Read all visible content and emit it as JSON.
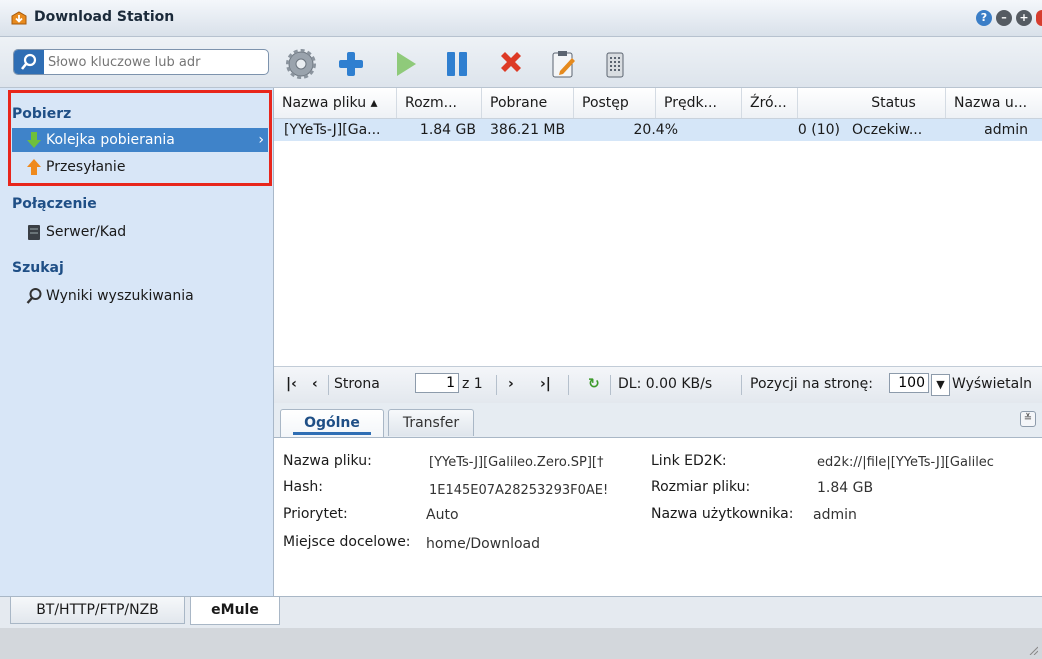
{
  "window": {
    "title": "Download Station"
  },
  "search": {
    "placeholder": "Słowo kluczowe lub adr"
  },
  "sidebar": {
    "group1": "Pobierz",
    "queue": "Kolejka pobierania",
    "upload": "Przesyłanie",
    "group2": "Połączenie",
    "server": "Serwer/Kad",
    "group3": "Szukaj",
    "results": "Wyniki wyszukiwania"
  },
  "grid": {
    "columns": [
      "Nazwa pliku ▴",
      "Rozm...",
      "Pobrane",
      "Postęp",
      "Prędk...",
      "Źró...",
      "Status",
      "Nazwa u..."
    ],
    "rows": [
      [
        "[YYeTs-J][Ga...",
        "1.84 GB",
        "386.21 MB",
        "20.4%",
        "",
        "0 (10)",
        "Oczekiw...",
        "admin"
      ]
    ]
  },
  "pager": {
    "page_label": "Strona",
    "page_value": "1",
    "of_label": "z 1",
    "dl_speed": "DL: 0.00 KB/s",
    "per_page_label": "Pozycji na stronę:",
    "per_page_value": "100",
    "display_label": "Wyświetaln"
  },
  "details": {
    "tabs": [
      "Ogólne",
      "Transfer"
    ],
    "filename_label": "Nazwa pliku:",
    "filename_value": "[YYeTs-J][Galileo.Zero.SP][†",
    "hash_label": "Hash:",
    "hash_value": "1E145E07A28253293F0AE!",
    "priority_label": "Priorytet:",
    "priority_value": "Auto",
    "dest_label": "Miejsce docelowe:",
    "dest_value": "home/Download",
    "link_label": "Link ED2K:",
    "link_value": "ed2k://|file|[YYeTs-J][Galilec",
    "size_label": "Rozmiar pliku:",
    "size_value": "1.84 GB",
    "user_label": "Nazwa użytkownika:",
    "user_value": "admin"
  },
  "bottom_tabs": [
    "BT/HTTP/FTP/NZB",
    "eMule"
  ]
}
